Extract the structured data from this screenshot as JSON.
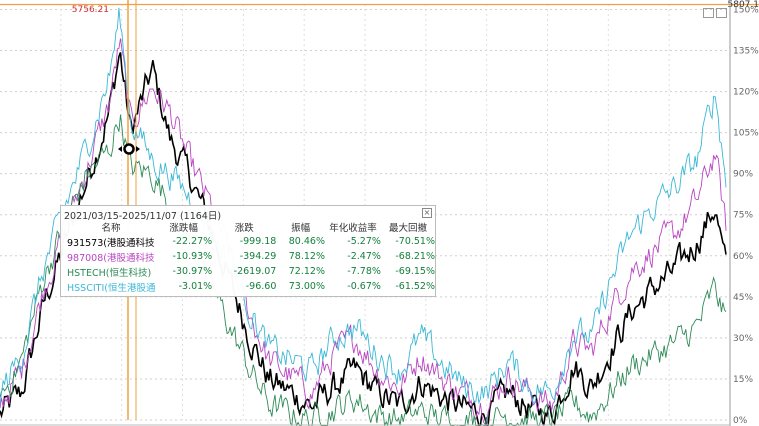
{
  "window_controls": {
    "restore_icon": "restore-icon",
    "close_icon": "close-icon"
  },
  "chart_data": {
    "type": "line",
    "ylim": [
      0,
      152
    ],
    "y_ticks": [
      "0%",
      "15%",
      "30%",
      "45%",
      "60%",
      "75%",
      "90%",
      "105%",
      "120%",
      "135%",
      "150%"
    ],
    "y_tick_values": [
      0,
      15,
      30,
      45,
      60,
      75,
      90,
      105,
      120,
      135,
      150
    ],
    "top_value_label": "5807.1",
    "peak_label": "5756.21",
    "grid": true,
    "series": [
      {
        "name": "931573(港股通科技)",
        "color": "#000000",
        "anchors": [
          [
            0,
            2
          ],
          [
            0.03,
            10
          ],
          [
            0.06,
            42
          ],
          [
            0.09,
            65
          ],
          [
            0.12,
            88
          ],
          [
            0.15,
            112
          ],
          [
            0.165,
            135
          ],
          [
            0.18,
            105
          ],
          [
            0.21,
            128
          ],
          [
            0.235,
            102
          ],
          [
            0.26,
            90
          ],
          [
            0.29,
            70
          ],
          [
            0.32,
            48
          ],
          [
            0.345,
            30
          ],
          [
            0.37,
            15
          ],
          [
            0.4,
            10
          ],
          [
            0.43,
            5
          ],
          [
            0.46,
            12
          ],
          [
            0.49,
            18
          ],
          [
            0.52,
            10
          ],
          [
            0.55,
            5
          ],
          [
            0.58,
            14
          ],
          [
            0.61,
            8
          ],
          [
            0.64,
            4
          ],
          [
            0.67,
            2
          ],
          [
            0.7,
            10
          ],
          [
            0.73,
            4
          ],
          [
            0.76,
            2
          ],
          [
            0.79,
            20
          ],
          [
            0.815,
            12
          ],
          [
            0.84,
            25
          ],
          [
            0.87,
            40
          ],
          [
            0.9,
            48
          ],
          [
            0.93,
            55
          ],
          [
            0.96,
            65
          ],
          [
            0.985,
            78
          ],
          [
            1.0,
            55
          ]
        ]
      },
      {
        "name": "987008(港股通科技)",
        "color": "#b846c2",
        "anchors": [
          [
            0,
            6
          ],
          [
            0.03,
            18
          ],
          [
            0.06,
            48
          ],
          [
            0.09,
            70
          ],
          [
            0.12,
            92
          ],
          [
            0.15,
            115
          ],
          [
            0.165,
            138
          ],
          [
            0.18,
            108
          ],
          [
            0.21,
            122
          ],
          [
            0.235,
            112
          ],
          [
            0.26,
            95
          ],
          [
            0.29,
            78
          ],
          [
            0.32,
            58
          ],
          [
            0.345,
            38
          ],
          [
            0.37,
            22
          ],
          [
            0.4,
            16
          ],
          [
            0.43,
            10
          ],
          [
            0.46,
            24
          ],
          [
            0.49,
            30
          ],
          [
            0.52,
            18
          ],
          [
            0.55,
            12
          ],
          [
            0.58,
            24
          ],
          [
            0.61,
            15
          ],
          [
            0.64,
            9
          ],
          [
            0.67,
            6
          ],
          [
            0.7,
            16
          ],
          [
            0.73,
            10
          ],
          [
            0.76,
            5
          ],
          [
            0.79,
            28
          ],
          [
            0.815,
            25
          ],
          [
            0.84,
            40
          ],
          [
            0.87,
            55
          ],
          [
            0.9,
            62
          ],
          [
            0.93,
            68
          ],
          [
            0.96,
            80
          ],
          [
            0.985,
            98
          ],
          [
            1.0,
            70
          ]
        ]
      },
      {
        "name": "HSTECH(恒生科技)",
        "color": "#2e8b57",
        "anchors": [
          [
            0,
            8
          ],
          [
            0.03,
            22
          ],
          [
            0.06,
            52
          ],
          [
            0.09,
            72
          ],
          [
            0.12,
            90
          ],
          [
            0.15,
            98
          ],
          [
            0.165,
            112
          ],
          [
            0.18,
            92
          ],
          [
            0.21,
            90
          ],
          [
            0.235,
            78
          ],
          [
            0.26,
            66
          ],
          [
            0.29,
            50
          ],
          [
            0.32,
            32
          ],
          [
            0.345,
            18
          ],
          [
            0.37,
            6
          ],
          [
            0.4,
            2
          ],
          [
            0.43,
            0
          ],
          [
            0.46,
            4
          ],
          [
            0.49,
            8
          ],
          [
            0.52,
            2
          ],
          [
            0.55,
            0
          ],
          [
            0.58,
            3
          ],
          [
            0.61,
            0
          ],
          [
            0.64,
            0
          ],
          [
            0.67,
            0
          ],
          [
            0.7,
            2
          ],
          [
            0.73,
            0
          ],
          [
            0.76,
            0
          ],
          [
            0.79,
            6
          ],
          [
            0.815,
            2
          ],
          [
            0.84,
            10
          ],
          [
            0.87,
            20
          ],
          [
            0.9,
            24
          ],
          [
            0.93,
            28
          ],
          [
            0.96,
            34
          ],
          [
            0.985,
            48
          ],
          [
            1.0,
            36
          ]
        ]
      },
      {
        "name": "HSSCITI(恒生港股通科技)",
        "color": "#3cb8d6",
        "anchors": [
          [
            0,
            10
          ],
          [
            0.03,
            24
          ],
          [
            0.06,
            55
          ],
          [
            0.09,
            78
          ],
          [
            0.12,
            100
          ],
          [
            0.15,
            125
          ],
          [
            0.165,
            148
          ],
          [
            0.18,
            110
          ],
          [
            0.21,
            95
          ],
          [
            0.235,
            90
          ],
          [
            0.26,
            82
          ],
          [
            0.29,
            70
          ],
          [
            0.32,
            55
          ],
          [
            0.345,
            40
          ],
          [
            0.37,
            26
          ],
          [
            0.4,
            22
          ],
          [
            0.43,
            18
          ],
          [
            0.46,
            30
          ],
          [
            0.49,
            34
          ],
          [
            0.52,
            24
          ],
          [
            0.55,
            18
          ],
          [
            0.58,
            30
          ],
          [
            0.61,
            20
          ],
          [
            0.64,
            12
          ],
          [
            0.67,
            10
          ],
          [
            0.7,
            22
          ],
          [
            0.73,
            12
          ],
          [
            0.76,
            10
          ],
          [
            0.79,
            32
          ],
          [
            0.815,
            30
          ],
          [
            0.84,
            50
          ],
          [
            0.87,
            68
          ],
          [
            0.9,
            78
          ],
          [
            0.93,
            85
          ],
          [
            0.96,
            95
          ],
          [
            0.985,
            120
          ],
          [
            1.0,
            88
          ]
        ]
      }
    ]
  },
  "stats_panel": {
    "title": "2021/03/15-2025/11/07 (1164日)",
    "headers": [
      "名称",
      "涨跌幅",
      "涨跌",
      "振幅",
      "年化收益率",
      "最大回撤"
    ],
    "rows": [
      {
        "name": "931573(港股通科技)",
        "color": "#000000",
        "change_pct": "-22.27%",
        "change": "-999.18",
        "amplitude": "80.46%",
        "annualized": "-5.27%",
        "max_drawdown": "-70.51%"
      },
      {
        "name": "987008(港股通科技)",
        "color": "#b846c2",
        "change_pct": "-10.93%",
        "change": "-394.29",
        "amplitude": "78.12%",
        "annualized": "-2.47%",
        "max_drawdown": "-68.21%"
      },
      {
        "name": "HSTECH(恒生科技)",
        "color": "#2e8b57",
        "change_pct": "-30.97%",
        "change": "-2619.07",
        "amplitude": "72.12%",
        "annualized": "-7.78%",
        "max_drawdown": "-69.15%"
      },
      {
        "name": "HSSCITI(恒生港股通科",
        "color": "#3cb8d6",
        "change_pct": "-3.01%",
        "change": "-96.60",
        "amplitude": "73.00%",
        "annualized": "-0.67%",
        "max_drawdown": "-61.52%"
      }
    ]
  },
  "close_glyph": "×"
}
